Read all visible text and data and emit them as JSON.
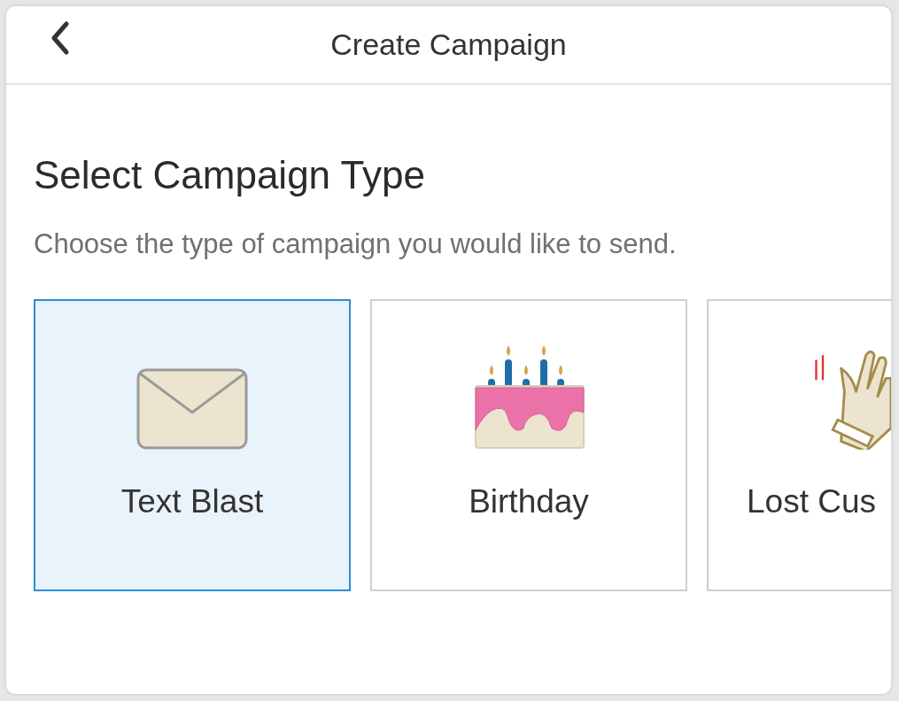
{
  "header": {
    "title": "Create Campaign"
  },
  "heading": "Select Campaign Type",
  "subtitle": "Choose the type of campaign you would like to send.",
  "types": [
    {
      "kind": "envelope",
      "label": "Text Blast",
      "selected": true
    },
    {
      "kind": "cake",
      "label": "Birthday",
      "selected": false
    },
    {
      "kind": "hand",
      "label": "Lost Cus",
      "selected": false
    }
  ]
}
